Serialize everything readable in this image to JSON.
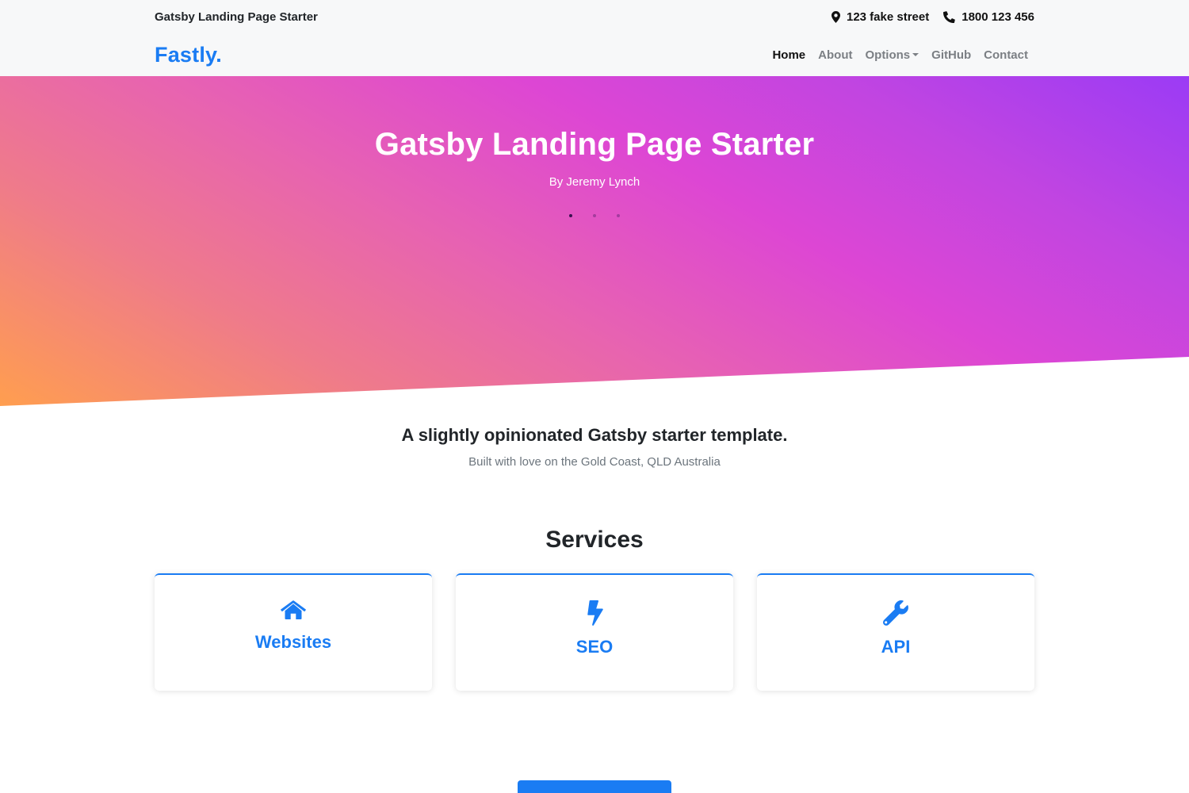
{
  "topbar": {
    "site_name": "Gatsby Landing Page Starter",
    "address": "123 fake street",
    "phone": "1800 123 456"
  },
  "nav": {
    "brand": "Fastly.",
    "items": [
      {
        "label": "Home",
        "active": true
      },
      {
        "label": "About"
      },
      {
        "label": "Options",
        "dropdown": true
      },
      {
        "label": "GitHub"
      },
      {
        "label": "Contact"
      }
    ]
  },
  "hero": {
    "title": "Gatsby Landing Page Starter",
    "subtitle": "By Jeremy Lynch",
    "slide_count": 3,
    "active_slide": 1,
    "gradient_colors": [
      "#ff9e4f",
      "#e762b2",
      "#dd46d4",
      "#9b3bf5"
    ]
  },
  "intro": {
    "heading": "A slightly opinionated Gatsby starter template.",
    "text": "Built with love on the Gold Coast, QLD Australia"
  },
  "services": {
    "title": "Services",
    "items": [
      {
        "icon": "home-icon",
        "label": "Websites"
      },
      {
        "icon": "bolt-icon",
        "label": "SEO"
      },
      {
        "icon": "wrench-icon",
        "label": "API"
      }
    ]
  },
  "colors": {
    "accent": "#1a7cf3",
    "nav_inactive": "#7b7f84",
    "header_bg": "#f7f8f9"
  }
}
